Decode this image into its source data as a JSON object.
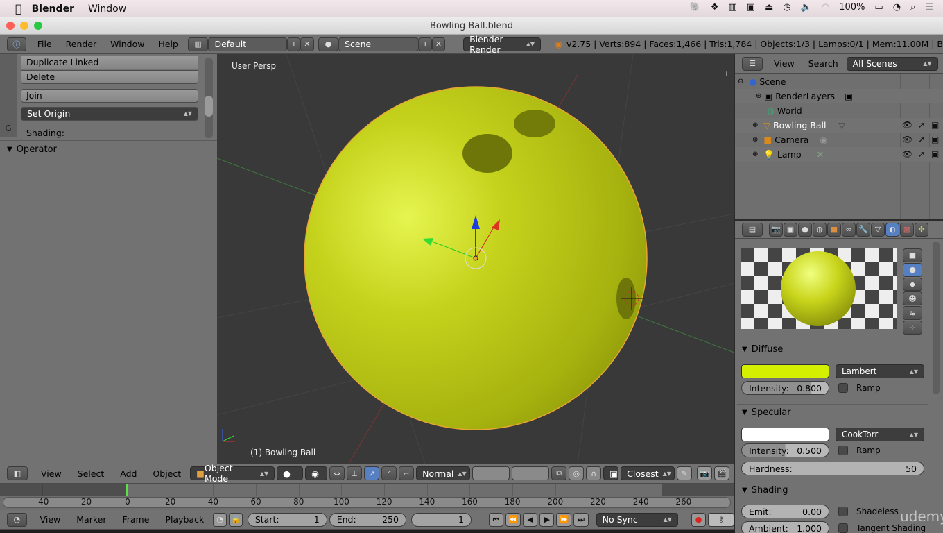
{
  "mac_menubar": {
    "app": "Blender",
    "menus": [
      "Window"
    ],
    "battery": "100%",
    "icons": [
      "evernote-icon",
      "dropbox-icon",
      "tiles-icon",
      "facetime-icon",
      "airplay-icon",
      "time-machine-icon",
      "volume-icon",
      "wifi-icon",
      "battery-icon",
      "clock-icon",
      "search-icon",
      "list-icon"
    ]
  },
  "window": {
    "title": "Bowling Ball.blend"
  },
  "info_header": {
    "menus": [
      "File",
      "Render",
      "Window",
      "Help"
    ],
    "layout": "Default",
    "scene": "Scene",
    "engine": "Blender Render",
    "stats": "v2.75 | Verts:894 | Faces:1,466 | Tris:1,784 | Objects:1/3 | Lamps:0/1 | Mem:11.00M | B"
  },
  "toolshelf": {
    "buttons": [
      "Duplicate Linked",
      "Delete",
      "Join"
    ],
    "set_origin": "Set Origin",
    "shading_label": "Shading:",
    "operator": "Operator"
  },
  "viewport": {
    "view_name": "User Persp",
    "object_label": "(1) Bowling Ball",
    "ball_color": "#c8d41a"
  },
  "view3d_header": {
    "menus": [
      "View",
      "Select",
      "Add",
      "Object"
    ],
    "mode": "Object Mode",
    "orientation": "Normal",
    "snap": "Closest"
  },
  "timeline": {
    "ticks": [
      "-40",
      "-20",
      "0",
      "20",
      "40",
      "60",
      "80",
      "100",
      "120",
      "140",
      "160",
      "180",
      "200",
      "220",
      "240",
      "260"
    ],
    "menus": [
      "View",
      "Marker",
      "Frame",
      "Playback"
    ],
    "start_label": "Start:",
    "start": "1",
    "end_label": "End:",
    "end": "250",
    "current": "1",
    "sync": "No Sync"
  },
  "outliner": {
    "menus": [
      "View",
      "Search"
    ],
    "filter": "All Scenes",
    "items": [
      {
        "name": "Scene"
      },
      {
        "name": "RenderLayers"
      },
      {
        "name": "World"
      },
      {
        "name": "Bowling Ball"
      },
      {
        "name": "Camera"
      },
      {
        "name": "Lamp"
      }
    ]
  },
  "properties": {
    "diffuse": {
      "title": "Diffuse",
      "color": "#d4f000",
      "shader": "Lambert",
      "intensity_label": "Intensity:",
      "intensity": "0.800",
      "ramp": "Ramp"
    },
    "specular": {
      "title": "Specular",
      "color": "#ffffff",
      "shader": "CookTorr",
      "intensity_label": "Intensity:",
      "intensity": "0.500",
      "ramp": "Ramp",
      "hardness_label": "Hardness:",
      "hardness": "50"
    },
    "shading": {
      "title": "Shading",
      "emit_label": "Emit:",
      "emit": "0.00",
      "shadeless": "Shadeless",
      "ambient_label": "Ambient:",
      "ambient": "1.000",
      "tangent": "Tangent Shading"
    }
  },
  "watermark": "udemy"
}
